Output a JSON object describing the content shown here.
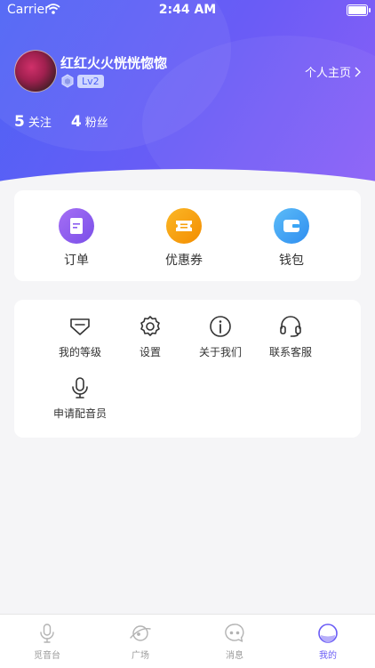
{
  "status_bar": {
    "carrier": "Carrier",
    "time": "2:44 AM"
  },
  "profile": {
    "username": "红红火火恍恍惚惚",
    "level": "Lv2",
    "homepage_link": "个人主页",
    "stats": [
      {
        "num": "5",
        "label": "关注"
      },
      {
        "num": "4",
        "label": "粉丝"
      }
    ]
  },
  "quick_actions": [
    {
      "label": "订单",
      "icon": "order-icon",
      "color": "#8a5cf0"
    },
    {
      "label": "优惠券",
      "icon": "coupon-icon",
      "color": "#f7a20f"
    },
    {
      "label": "钱包",
      "icon": "wallet-icon",
      "color": "#3aa5f5"
    }
  ],
  "menu": [
    {
      "label": "我的等级",
      "icon": "level-icon"
    },
    {
      "label": "设置",
      "icon": "settings-icon"
    },
    {
      "label": "关于我们",
      "icon": "info-icon"
    },
    {
      "label": "联系客服",
      "icon": "headset-icon"
    },
    {
      "label": "申请配音员",
      "icon": "microphone-icon"
    }
  ],
  "tabbar": [
    {
      "label": "觅音台",
      "icon": "mic-tab-icon",
      "active": false
    },
    {
      "label": "广场",
      "icon": "planet-tab-icon",
      "active": false
    },
    {
      "label": "消息",
      "icon": "message-tab-icon",
      "active": false
    },
    {
      "label": "我的",
      "icon": "profile-tab-icon",
      "active": true
    }
  ],
  "colors": {
    "accent": "#6a5cf6",
    "header_start": "#4d63f5",
    "header_end": "#8a5ff7"
  }
}
